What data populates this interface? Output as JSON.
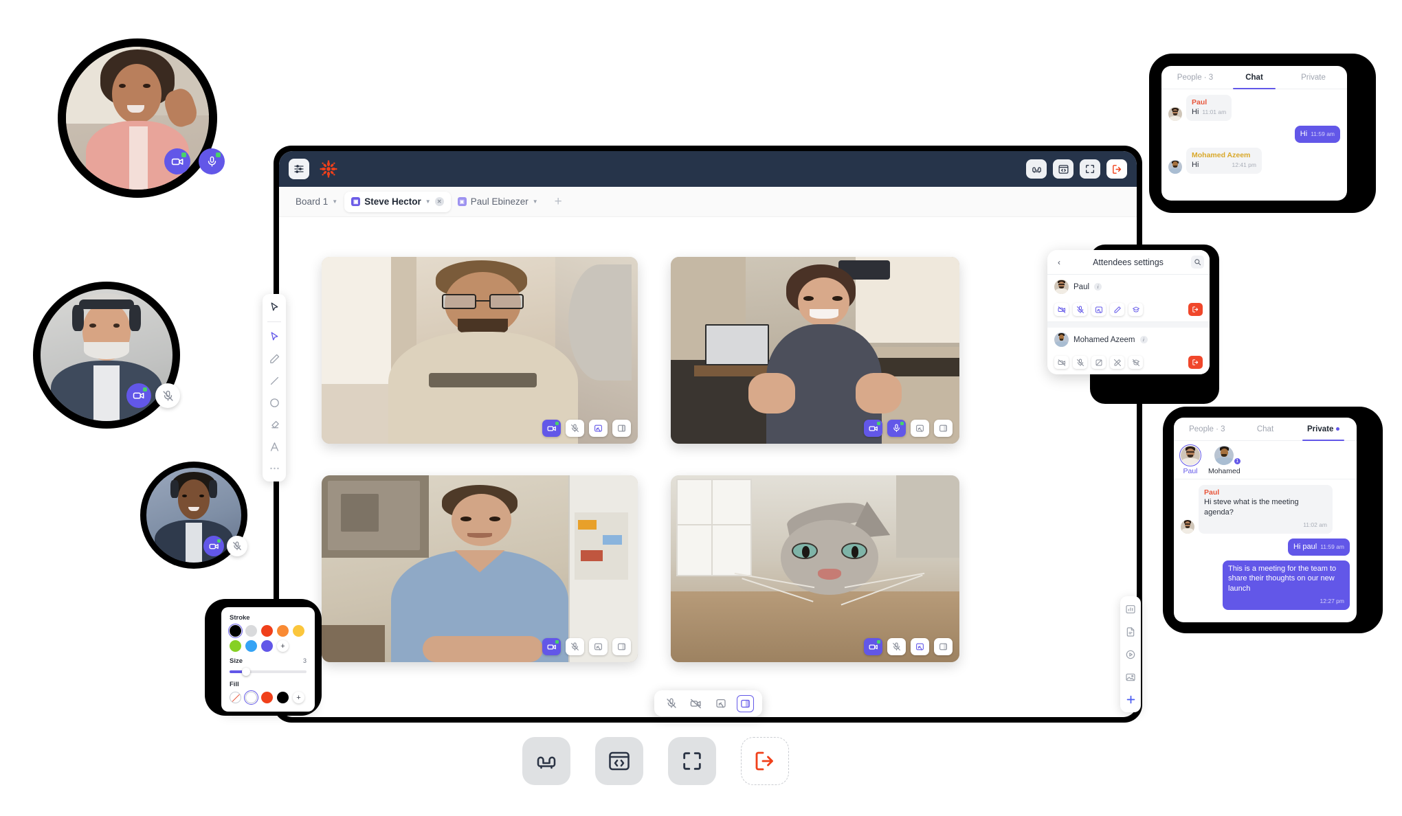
{
  "app": {
    "header": {
      "menu_icon": "sliders-icon",
      "logo_icon": "snowflake-logo-icon",
      "actions": [
        {
          "name": "lounge-button",
          "icon": "sofa-icon",
          "label": "Lounge"
        },
        {
          "name": "code-share-button",
          "icon": "code-window-icon",
          "label": "Code"
        },
        {
          "name": "fullscreen-button",
          "icon": "fullscreen-icon",
          "label": "Fullscreen"
        },
        {
          "name": "leave-meeting-button",
          "icon": "exit-icon",
          "label": "Leave"
        }
      ]
    },
    "tabs": [
      {
        "label": "Board 1",
        "active": false,
        "has_square": false,
        "closable": false
      },
      {
        "label": "Steve Hector",
        "active": true,
        "has_square": true,
        "closable": true
      },
      {
        "label": "Paul Ebinezer",
        "active": false,
        "has_square": true,
        "closable": false
      }
    ],
    "add_tab_label": "+"
  },
  "video_tiles": [
    {
      "name": "video-tile-1",
      "controls": [
        {
          "icon": "camera-on-icon",
          "state": "on",
          "indicator": true
        },
        {
          "icon": "mic-off-icon",
          "state": "off",
          "indicator": false
        },
        {
          "icon": "screen-share-icon",
          "state": "off",
          "indicator": false
        },
        {
          "icon": "layout-icon",
          "state": "off",
          "indicator": false
        }
      ]
    },
    {
      "name": "video-tile-2",
      "controls": [
        {
          "icon": "camera-on-icon",
          "state": "on",
          "indicator": true
        },
        {
          "icon": "mic-on-icon",
          "state": "on",
          "indicator": true
        },
        {
          "icon": "screen-share-icon",
          "state": "off",
          "indicator": false
        },
        {
          "icon": "layout-icon",
          "state": "off",
          "indicator": false
        }
      ]
    },
    {
      "name": "video-tile-3",
      "controls": [
        {
          "icon": "camera-on-icon",
          "state": "on",
          "indicator": true
        },
        {
          "icon": "mic-off-icon",
          "state": "off",
          "indicator": false
        },
        {
          "icon": "screen-share-icon",
          "state": "off",
          "indicator": false
        },
        {
          "icon": "layout-icon",
          "state": "off",
          "indicator": false
        }
      ]
    },
    {
      "name": "video-tile-4",
      "controls": [
        {
          "icon": "camera-on-icon",
          "state": "on",
          "indicator": true
        },
        {
          "icon": "mic-off-icon",
          "state": "off",
          "indicator": false
        },
        {
          "icon": "screen-share-icon",
          "state": "off",
          "indicator": false
        },
        {
          "icon": "layout-icon",
          "state": "off",
          "indicator": false
        }
      ]
    }
  ],
  "tool_rail": [
    {
      "icon": "hand-select-icon",
      "active": false
    },
    {
      "icon": "cursor-pointer-icon",
      "active": true
    },
    {
      "icon": "pencil-icon",
      "active": false
    },
    {
      "icon": "line-icon",
      "active": false
    },
    {
      "icon": "circle-icon",
      "active": false
    },
    {
      "icon": "eraser-icon",
      "active": false
    },
    {
      "icon": "text-icon",
      "active": false
    },
    {
      "icon": "more-dots-icon",
      "active": false
    }
  ],
  "stroke_panel": {
    "stroke_label": "Stroke",
    "stroke_colors": [
      "#000000",
      "#d9dadc",
      "#f0401a",
      "#f98a33",
      "#fbc63c",
      "#86d024",
      "#35a3f5",
      "#6257e8"
    ],
    "stroke_selected_index": 0,
    "add_color_label": "+",
    "size_label": "Size",
    "size_value": "3",
    "fill_label": "Fill",
    "fill_swatches": [
      "none",
      "#ffffff",
      "#f0401a",
      "#000000"
    ],
    "fill_selected_index": 1,
    "fill_add_label": "+"
  },
  "bottom_bar": [
    {
      "icon": "mic-off-icon",
      "selected": false
    },
    {
      "icon": "camera-off-icon",
      "selected": false
    },
    {
      "icon": "screen-share-icon",
      "selected": false
    },
    {
      "icon": "layout-icon",
      "selected": true
    }
  ],
  "right_rail": [
    {
      "icon": "chart-icon"
    },
    {
      "icon": "document-icon"
    },
    {
      "icon": "play-video-icon"
    },
    {
      "icon": "image-icon"
    },
    {
      "icon": "plus-icon"
    }
  ],
  "attendees": {
    "back_icon": "chevron-left-icon",
    "title": "Attendees settings",
    "search_icon": "search-icon",
    "people": [
      {
        "name": "Paul",
        "info_label": "i",
        "actions": [
          {
            "icon": "camera-off-icon",
            "active": true
          },
          {
            "icon": "mic-off-icon",
            "active": true
          },
          {
            "icon": "screen-share-icon",
            "active": true
          },
          {
            "icon": "pen-icon",
            "active": true
          },
          {
            "icon": "presenter-hat-icon",
            "active": true
          }
        ],
        "remove_icon": "remove-user-icon"
      },
      {
        "name": "Mohamed Azeem",
        "info_label": "i",
        "actions": [
          {
            "icon": "camera-off-icon",
            "active": false
          },
          {
            "icon": "mic-off-icon",
            "active": false
          },
          {
            "icon": "screen-share-off-icon",
            "active": false
          },
          {
            "icon": "pen-off-icon",
            "active": false
          },
          {
            "icon": "presenter-hat-off-icon",
            "active": false
          }
        ],
        "remove_icon": "remove-user-icon"
      }
    ]
  },
  "chat_panel": {
    "tabs": [
      {
        "label": "People · 3",
        "active": false,
        "dot": false
      },
      {
        "label": "Chat",
        "active": true,
        "dot": false
      },
      {
        "label": "Private",
        "active": false,
        "dot": false
      }
    ],
    "messages": [
      {
        "side": "them",
        "author": "Paul",
        "author_color": "#e8553a",
        "text": "Hi",
        "time": "11:01 am"
      },
      {
        "side": "me",
        "author": "",
        "author_color": "",
        "text": "Hi",
        "time": "11:59 am"
      },
      {
        "side": "them",
        "author": "Mohamed Azeem",
        "author_color": "#d9a82a",
        "text": "Hi",
        "time": "12:41 pm"
      }
    ]
  },
  "private_panel": {
    "tabs": [
      {
        "label": "People · 3",
        "active": false,
        "dot": false
      },
      {
        "label": "Chat",
        "active": false,
        "dot": false
      },
      {
        "label": "Private",
        "active": true,
        "dot": true
      }
    ],
    "people": [
      {
        "name": "Paul",
        "selected": true,
        "badge": ""
      },
      {
        "name": "Mohamed",
        "selected": false,
        "badge": "1"
      }
    ],
    "messages": [
      {
        "side": "them",
        "author": "Paul",
        "author_color": "#e8553a",
        "text": "Hi steve what is the meeting agenda?",
        "time": "11:02 am"
      },
      {
        "side": "me",
        "author": "",
        "author_color": "",
        "text": "Hi paul",
        "time": "11:59 am"
      },
      {
        "side": "me",
        "author": "",
        "author_color": "",
        "text": "This is a meeting for the team to share their thoughts on our new launch",
        "time": "12:27 pm"
      }
    ]
  },
  "floating_bubbles": [
    {
      "name": "floating-bubble-1",
      "controls": [
        {
          "icon": "camera-on-icon",
          "state": "on",
          "indicator": true
        },
        {
          "icon": "mic-on-icon",
          "state": "on",
          "indicator": true
        }
      ]
    },
    {
      "name": "floating-bubble-2",
      "controls": [
        {
          "icon": "camera-on-icon",
          "state": "on",
          "indicator": true
        },
        {
          "icon": "mic-off-icon",
          "state": "off",
          "indicator": false
        }
      ]
    },
    {
      "name": "floating-bubble-3",
      "controls": [
        {
          "icon": "camera-on-icon",
          "state": "on",
          "indicator": true
        },
        {
          "icon": "mic-off-icon",
          "state": "off",
          "indicator": false
        }
      ]
    }
  ],
  "launchers": [
    {
      "name": "lounge-launcher",
      "icon": "sofa-icon",
      "style": "filled"
    },
    {
      "name": "code-launcher",
      "icon": "code-window-icon",
      "style": "filled"
    },
    {
      "name": "fullscreen-launcher",
      "icon": "fullscreen-icon",
      "style": "filled"
    },
    {
      "name": "leave-launcher",
      "icon": "exit-icon",
      "style": "dashed"
    }
  ],
  "colors": {
    "accent": "#6257e8",
    "header_bg": "#26344a",
    "danger": "#f0472b",
    "green_indicator": "#49d16b"
  }
}
